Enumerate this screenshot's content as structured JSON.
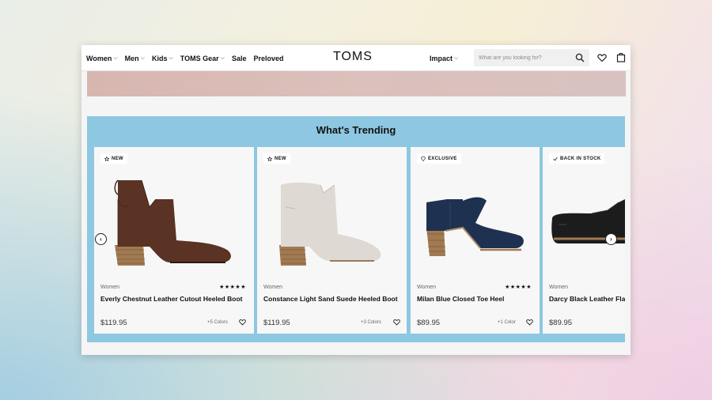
{
  "header": {
    "nav": [
      {
        "label": "Women",
        "dropdown": true
      },
      {
        "label": "Men",
        "dropdown": true
      },
      {
        "label": "Kids",
        "dropdown": true
      },
      {
        "label": "TOMS Gear",
        "dropdown": true
      },
      {
        "label": "Sale",
        "dropdown": false
      },
      {
        "label": "Preloved",
        "dropdown": false
      }
    ],
    "logo": "TOMS",
    "impact_label": "Impact",
    "search_placeholder": "What are you looking for?",
    "icons": [
      "search-icon",
      "heart-icon",
      "bag-icon"
    ]
  },
  "trending": {
    "title": "What's Trending",
    "products": [
      {
        "badge": "NEW",
        "badge_icon": "star-icon",
        "category": "Women",
        "rating_stars": "★★★★★",
        "name": "Everly Chestnut Leather Cutout Heeled Boot",
        "price": "$119.95",
        "colors": "+5 Colors"
      },
      {
        "badge": "NEW",
        "badge_icon": "star-icon",
        "category": "Women",
        "rating_stars": "",
        "name": "Constance Light Sand Suede Heeled Boot",
        "price": "$119.95",
        "colors": "+3 Colors"
      },
      {
        "badge": "EXCLUSIVE",
        "badge_icon": "diamond-icon",
        "category": "Women",
        "rating_stars": "★★★★★",
        "name": "Milan Blue Closed Toe Heel",
        "price": "$89.95",
        "colors": "+1 Color"
      },
      {
        "badge": "BACK IN STOCK",
        "badge_icon": "check-icon",
        "category": "Women",
        "rating_stars": "",
        "name": "Darcy Black Leather Flat",
        "price": "$89.95",
        "colors": ""
      }
    ],
    "prev_arrow": "‹",
    "next_arrow": "›"
  },
  "colors": {
    "trending_bg": "#8ec7e2",
    "banner": "#d8b6b0"
  }
}
